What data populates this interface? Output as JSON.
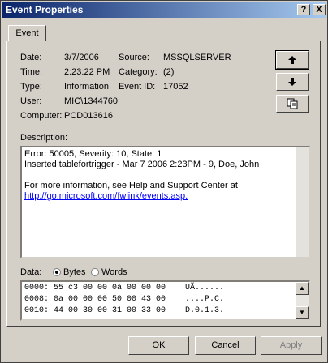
{
  "window": {
    "title": "Event Properties",
    "help_glyph": "?",
    "close_glyph": "X"
  },
  "tab": {
    "label": "Event"
  },
  "fields": {
    "date_label": "Date:",
    "date": "3/7/2006",
    "time_label": "Time:",
    "time": "2:23:22 PM",
    "type_label": "Type:",
    "type": "Information",
    "user_label": "User:",
    "user": "MIC\\1344760",
    "computer_label": "Computer:",
    "computer": "PCD013616",
    "source_label": "Source:",
    "source": "MSSQLSERVER",
    "category_label": "Category:",
    "category": "(2)",
    "eventid_label": "Event ID:",
    "eventid": "17052"
  },
  "nav": {
    "up_icon": "arrow-up-icon",
    "down_icon": "arrow-down-icon",
    "copy_icon": "copy-icon"
  },
  "description": {
    "label": "Description:",
    "line1": "Error: 50005, Severity: 10, State: 1",
    "line2": "Inserted tablefortrigger - Mar  7 2006  2:23PM - 9, Doe, John",
    "line3": "For more information, see Help and Support Center at",
    "link": "http://go.microsoft.com/fwlink/events.asp."
  },
  "data": {
    "label": "Data:",
    "bytes_label": "Bytes",
    "words_label": "Words",
    "selected": "Bytes",
    "rows": [
      "0000: 55 c3 00 00 0a 00 00 00    UÃ......",
      "0008: 0a 00 00 00 50 00 43 00    ....P.C.",
      "0010: 44 00 30 00 31 00 33 00    D.0.1.3."
    ]
  },
  "buttons": {
    "ok": "OK",
    "cancel": "Cancel",
    "apply": "Apply"
  }
}
